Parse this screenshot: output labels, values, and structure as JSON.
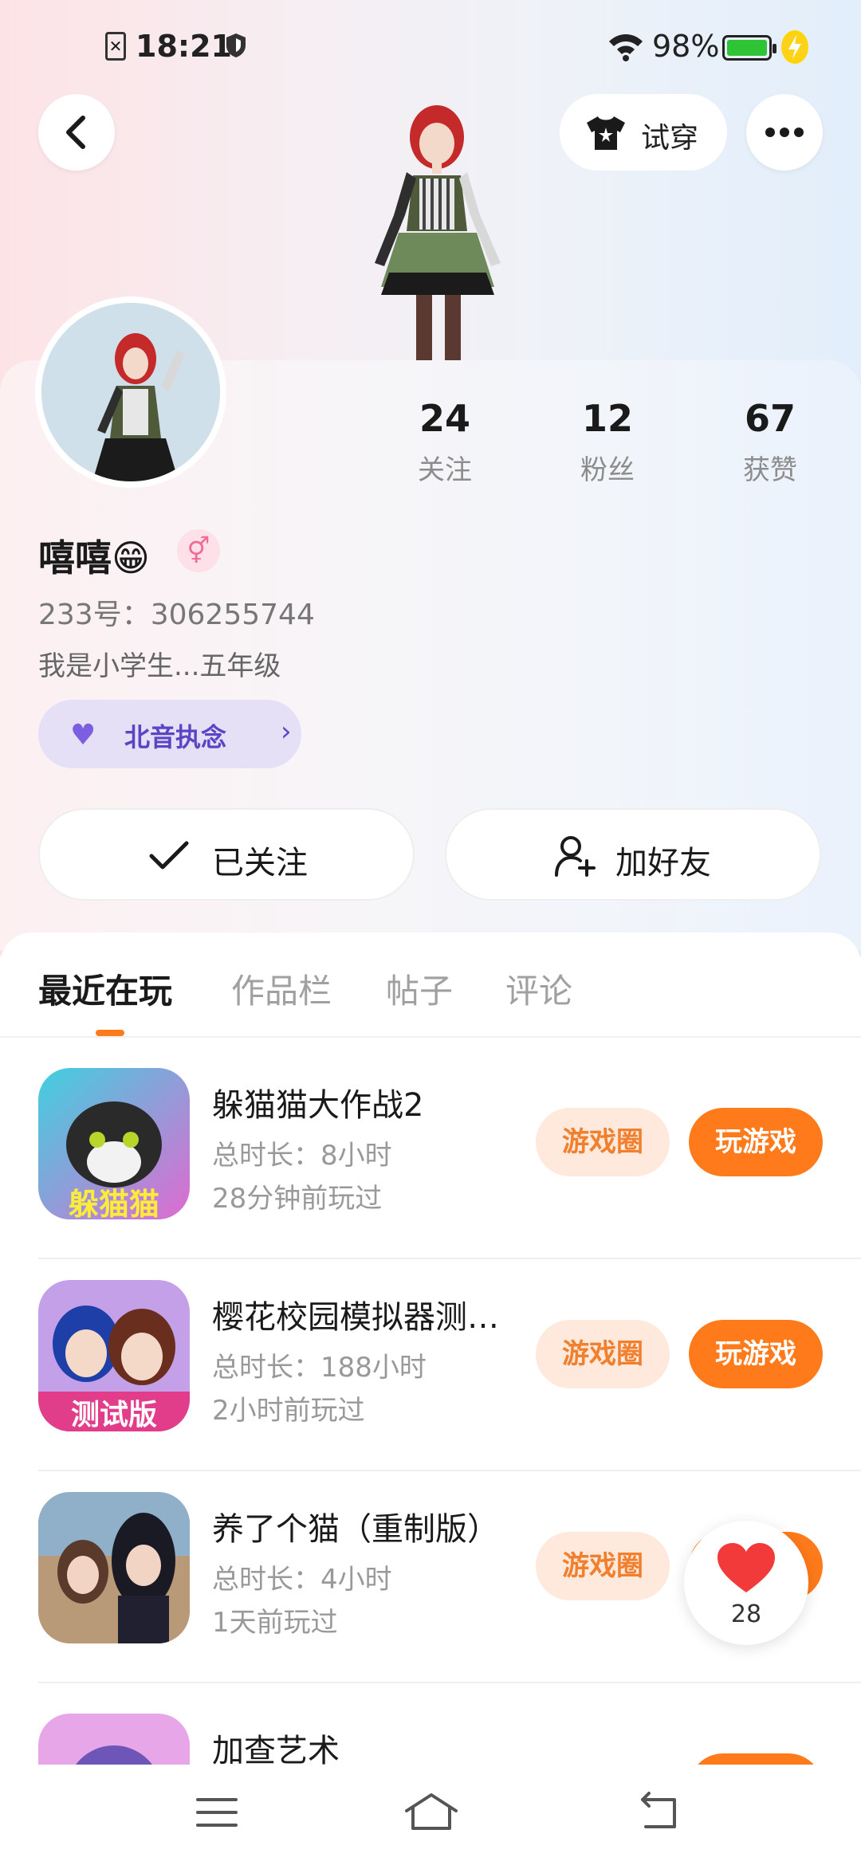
{
  "status_bar": {
    "time": "18:21",
    "battery": "98%"
  },
  "header": {
    "try_on_label": "试穿"
  },
  "profile": {
    "name": "嘻嘻😁",
    "gender_symbol": "⚥",
    "uid": "233号：306255744",
    "bio": "我是小学生...五年级",
    "tag": "北音执念",
    "stats": [
      {
        "value": "24",
        "label": "关注"
      },
      {
        "value": "12",
        "label": "粉丝"
      },
      {
        "value": "67",
        "label": "获赞"
      }
    ],
    "follow_label": "已关注",
    "add_friend_label": "加好友"
  },
  "tabs": [
    "最近在玩",
    "作品栏",
    "帖子",
    "评论"
  ],
  "games": [
    {
      "title": "躲猫猫大作战2",
      "duration": "总时长：8小时",
      "last_played": "28分钟前玩过",
      "icon_text": "躲猫猫"
    },
    {
      "title": "樱花校园模拟器测…",
      "duration": "总时长：188小时",
      "last_played": "2小时前玩过",
      "icon_text": "测试版"
    },
    {
      "title": "养了个猫（重制版）",
      "duration": "总时长：4小时",
      "last_played": "1天前玩过",
      "icon_text": ""
    },
    {
      "title": "加查艺术",
      "duration": "",
      "last_played": "",
      "icon_text": ""
    }
  ],
  "buttons": {
    "circle": "游戏圈",
    "play": "玩游戏"
  },
  "like_count": "28",
  "colors": {
    "accent": "#ff7a1a",
    "tag_bg": "#e6e0f7",
    "circle_bg": "#ffe8dc"
  }
}
